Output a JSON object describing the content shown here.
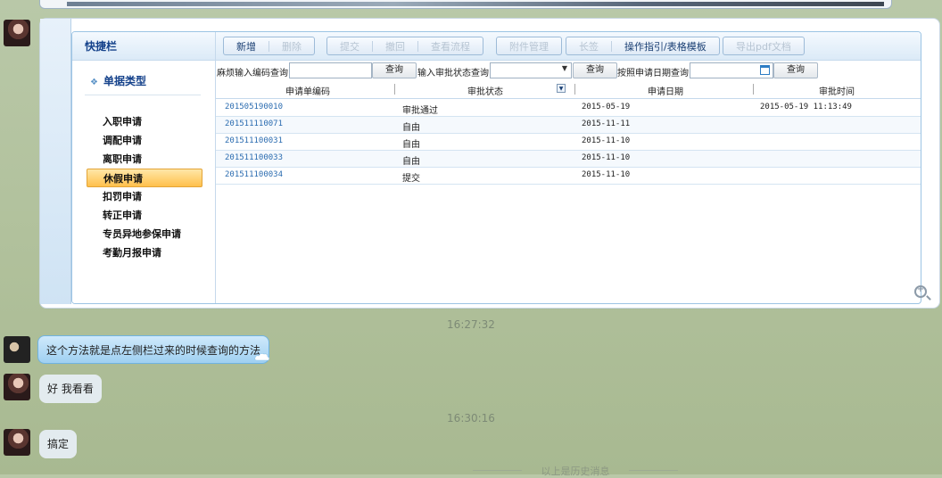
{
  "sidebar": {
    "header": "快捷栏",
    "section_title": "单据类型",
    "items": [
      {
        "label": "入职申请",
        "active": false
      },
      {
        "label": "调配申请",
        "active": false
      },
      {
        "label": "离职申请",
        "active": false
      },
      {
        "label": "休假申请",
        "active": true
      },
      {
        "label": "扣罚申请",
        "active": false
      },
      {
        "label": "转正申请",
        "active": false
      },
      {
        "label": "专员异地参保申请",
        "active": false
      },
      {
        "label": "考勤月报申请",
        "active": false
      }
    ]
  },
  "toolbar": {
    "add": "新增",
    "delete": "删除",
    "submit": "提交",
    "recall": "撤回",
    "view_flow": "查看流程",
    "attachment": "附件管理",
    "print": "长签",
    "guide": "操作指引/表格模板",
    "export": "导出pdf文档"
  },
  "search": {
    "code_label": "麻烦输入编码查询",
    "code_btn": "查询",
    "status_label": "输入审批状态查询",
    "status_btn": "查询",
    "date_label": "按照申请日期查询",
    "date_btn": "查询"
  },
  "table": {
    "headers": [
      "申请单编码",
      "审批状态",
      "申请日期",
      "审批时间"
    ],
    "rows": [
      {
        "code": "201505190010",
        "status": "审批通过",
        "date": "2015-05-19",
        "approved": "2015-05-19 11:13:49"
      },
      {
        "code": "201511110071",
        "status": "自由",
        "date": "2015-11-11",
        "approved": ""
      },
      {
        "code": "201511100031",
        "status": "自由",
        "date": "2015-11-10",
        "approved": ""
      },
      {
        "code": "201511100033",
        "status": "自由",
        "date": "2015-11-10",
        "approved": ""
      },
      {
        "code": "201511100034",
        "status": "提交",
        "date": "2015-11-10",
        "approved": ""
      }
    ]
  },
  "chat": {
    "time1": "16:27:32",
    "msg1": "这个方法就是点左侧栏过来的时候查询的方法",
    "msg2": "好 我看看",
    "time2": "16:30:16",
    "msg3": "搞定",
    "history": "以上是历史消息"
  },
  "colors": {
    "accent": "#15428b",
    "active_item": "#ffc04c",
    "bubble_blue": "#9fd0f1"
  }
}
